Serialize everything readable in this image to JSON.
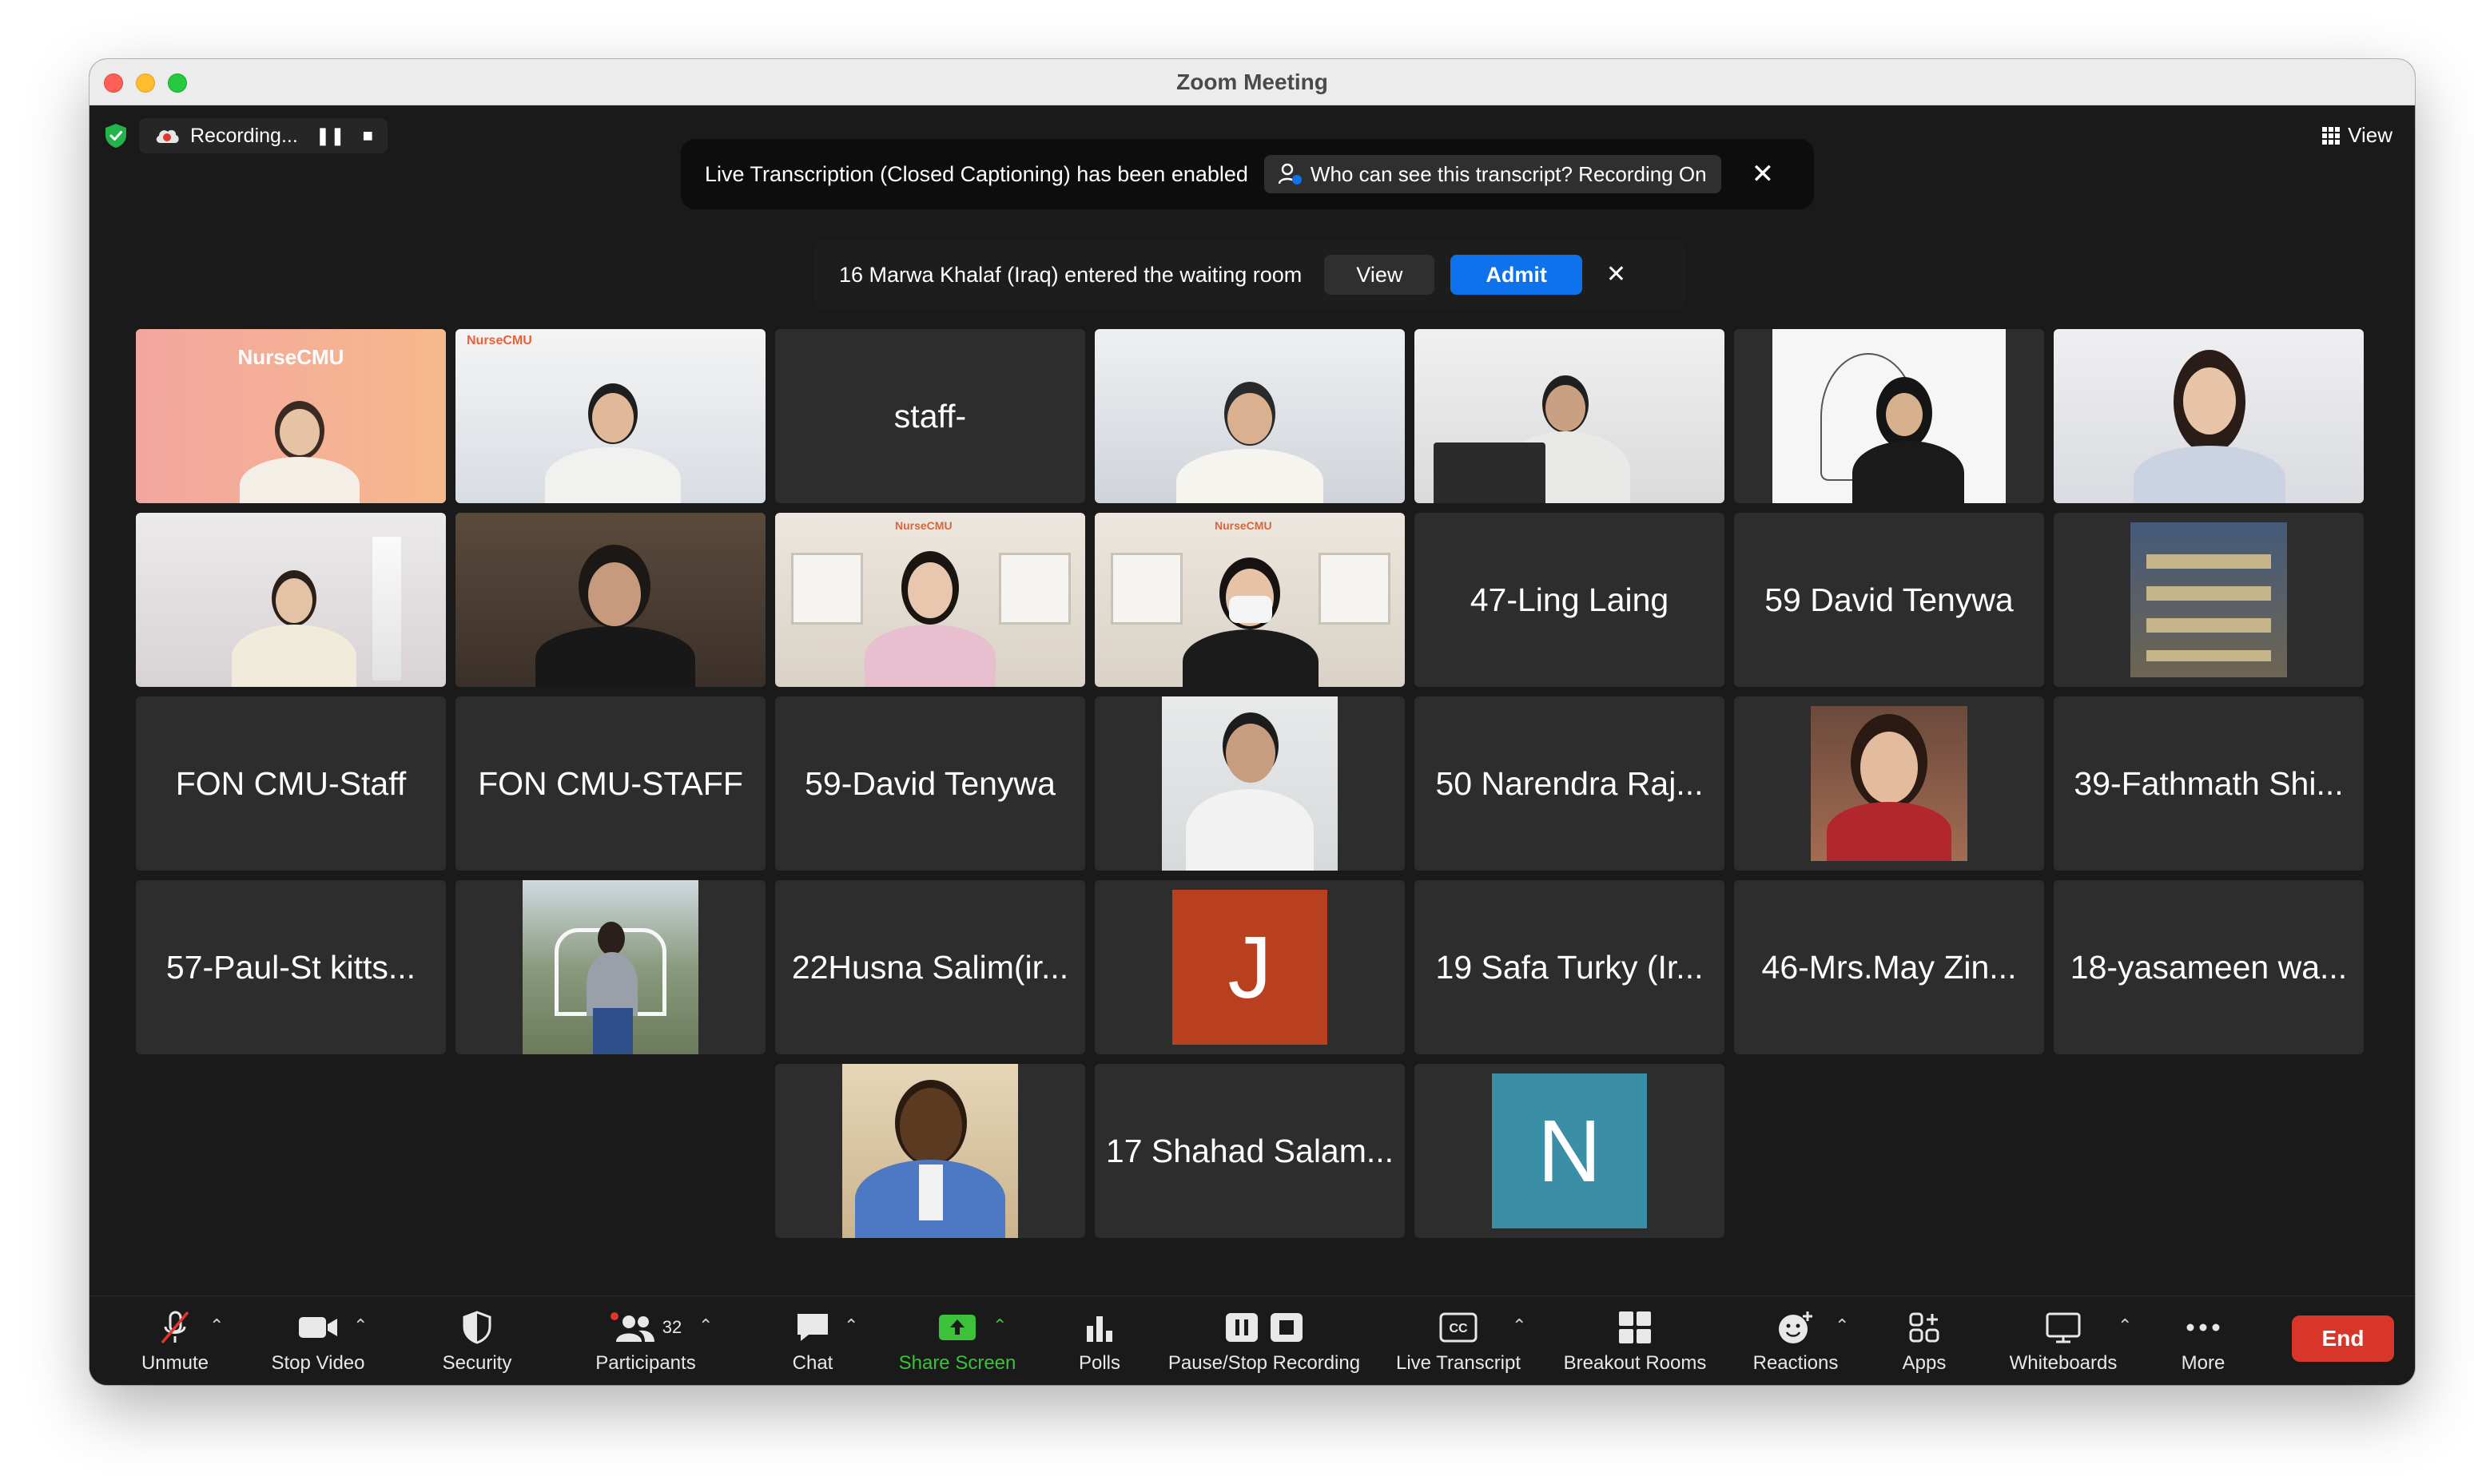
{
  "window": {
    "title": "Zoom Meeting"
  },
  "topbar": {
    "recording_label": "Recording...",
    "view_label": "View"
  },
  "caption_banner": {
    "message": "Live Transcription (Closed Captioning) has been enabled",
    "chip_label": "Who can see this transcript? Recording On"
  },
  "waiting_banner": {
    "message": "16 Marwa Khalaf (Iraq) entered the waiting room",
    "view_label": "View",
    "admit_label": "Admit"
  },
  "tiles": {
    "r1c1": {
      "kind": "video",
      "overlay_text": "NurseCMU"
    },
    "r1c2": {
      "kind": "video",
      "overlay_text": "NurseCMU"
    },
    "r1c3": {
      "kind": "name",
      "name": "staff-"
    },
    "r1c4": {
      "kind": "video"
    },
    "r1c5": {
      "kind": "video"
    },
    "r1c6": {
      "kind": "video"
    },
    "r1c7": {
      "kind": "video"
    },
    "r2c1": {
      "kind": "video"
    },
    "r2c2": {
      "kind": "video"
    },
    "r2c3": {
      "kind": "video",
      "overlay_text": "NurseCMU"
    },
    "r2c4": {
      "kind": "video",
      "overlay_text": "NurseCMU"
    },
    "r2c5": {
      "kind": "name",
      "name": "47-Ling Laing"
    },
    "r2c6": {
      "kind": "name",
      "name": "59 David  Tenywa"
    },
    "r2c7": {
      "kind": "photo"
    },
    "r3c1": {
      "kind": "name",
      "name": "FON CMU-Staff"
    },
    "r3c2": {
      "kind": "name",
      "name": "FON CMU-STAFF"
    },
    "r3c3": {
      "kind": "name",
      "name": "59-David Tenywa"
    },
    "r3c4": {
      "kind": "photo"
    },
    "r3c5": {
      "kind": "name",
      "name": "50 Narendra Raj..."
    },
    "r3c6": {
      "kind": "photo"
    },
    "r3c7": {
      "kind": "name",
      "name": "39-Fathmath Shi..."
    },
    "r4c1": {
      "kind": "name",
      "name": "57-Paul-St kitts..."
    },
    "r4c2": {
      "kind": "photo"
    },
    "r4c3": {
      "kind": "name",
      "name": "22Husna Salim(ir..."
    },
    "r4c4": {
      "kind": "avatar",
      "letter": "J",
      "color": "#b9401f"
    },
    "r4c5": {
      "kind": "name",
      "name": "19 Safa Turky (Ir..."
    },
    "r4c6": {
      "kind": "name",
      "name": "46-Mrs.May Zin..."
    },
    "r4c7": {
      "kind": "name",
      "name": "18-yasameen wa..."
    },
    "r5c3": {
      "kind": "photo"
    },
    "r5c4": {
      "kind": "name",
      "name": "17 Shahad Salam..."
    },
    "r5c5": {
      "kind": "avatar",
      "letter": "N",
      "color": "#3a8fa6"
    }
  },
  "toolbar": {
    "unmute": "Unmute",
    "stop_video": "Stop Video",
    "security": "Security",
    "participants": "Participants",
    "participants_count": "32",
    "chat": "Chat",
    "share_screen": "Share Screen",
    "polls": "Polls",
    "pause_stop_recording": "Pause/Stop Recording",
    "live_transcript": "Live Transcript",
    "breakout_rooms": "Breakout Rooms",
    "reactions": "Reactions",
    "apps": "Apps",
    "whiteboards": "Whiteboards",
    "more": "More",
    "end": "End"
  },
  "colors": {
    "accent_blue": "#0e72ed",
    "share_green": "#3cc13b",
    "end_red": "#d9362b",
    "active_speaker_border": "#3cc13b"
  }
}
